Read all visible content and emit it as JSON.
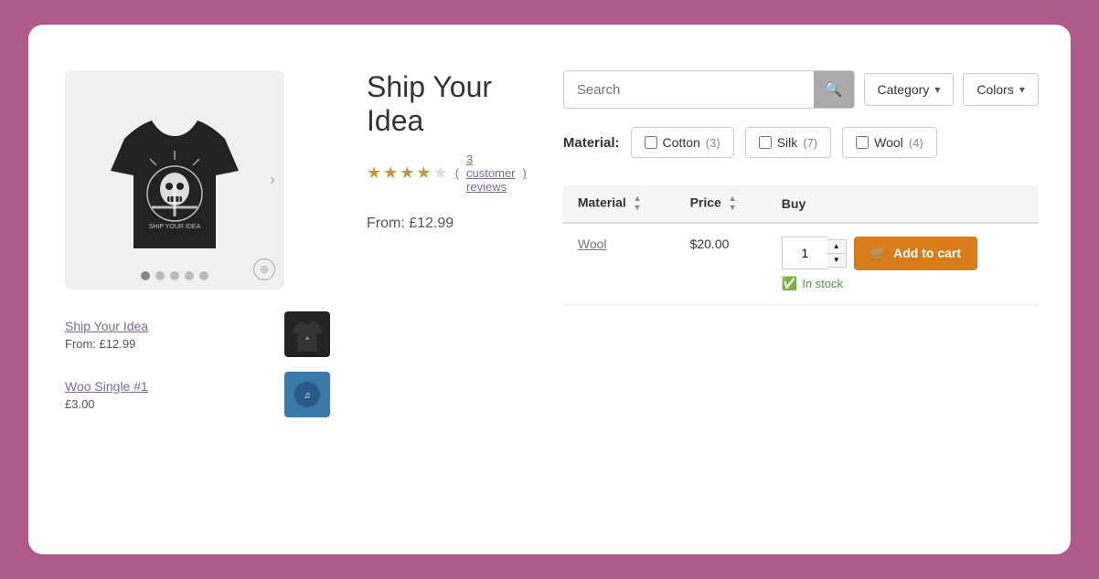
{
  "page": {
    "card": {
      "product": {
        "title": "Ship Your Idea",
        "rating": 3.5,
        "rating_count": "3 customer reviews",
        "from_price": "From: £12.99",
        "stars": [
          1,
          1,
          1,
          0.5,
          0
        ]
      },
      "image_dots": [
        true,
        false,
        false,
        false,
        false
      ],
      "product_list": [
        {
          "name": "Ship Your Idea",
          "price": "From: £12.99",
          "thumb_type": "shirt"
        },
        {
          "name": "Woo Single #1",
          "price": "£3.00",
          "thumb_type": "blue"
        }
      ],
      "filters": {
        "search_placeholder": "Search",
        "category_label": "Category",
        "colors_label": "Colors"
      },
      "material_filter": {
        "label": "Material:",
        "options": [
          {
            "name": "Cotton",
            "count": 3
          },
          {
            "name": "Silk",
            "count": 7
          },
          {
            "name": "Wool",
            "count": 4
          }
        ]
      },
      "table": {
        "headers": [
          {
            "label": "Material",
            "sortable": true
          },
          {
            "label": "Price",
            "sortable": true
          },
          {
            "label": "Buy",
            "sortable": false
          }
        ],
        "rows": [
          {
            "material": "Wool",
            "price": "$20.00",
            "qty": "1",
            "in_stock": "In stock"
          }
        ]
      },
      "add_to_cart_label": "Add to cart",
      "cart_icon": "🛒"
    }
  }
}
